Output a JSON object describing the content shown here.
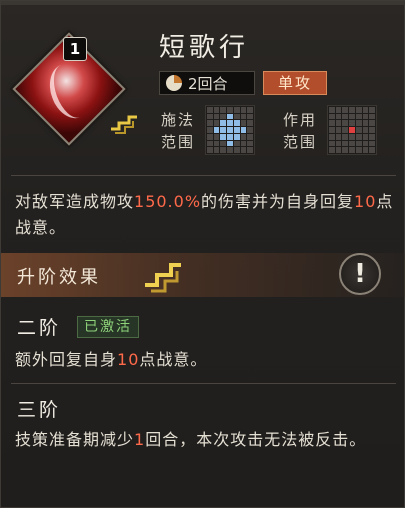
{
  "skill": {
    "level": "1",
    "name": "短歌行",
    "rounds_label": "2回合",
    "attack_type": "单攻",
    "cast_range_label_1": "施法",
    "cast_range_label_2": "范围",
    "effect_range_label_1": "作用",
    "effect_range_label_2": "范围",
    "description": {
      "part1": "对敌军造成物攻",
      "value1": "150.0%",
      "part2": "的伤害并为自身回复",
      "value2": "10",
      "part3": "点战意。"
    }
  },
  "upgrade": {
    "title": "升阶效果",
    "info_icon": "!",
    "tiers": [
      {
        "title": "二阶",
        "status": "已激活",
        "desc_part1": "额外回复自身",
        "desc_value": "10",
        "desc_part2": "点战意。"
      },
      {
        "title": "三阶",
        "desc_part1": "技策准备期减少",
        "desc_value": "1",
        "desc_part2": "回合，本次攻击无法被反击。"
      }
    ]
  },
  "colors": {
    "highlight": "#ff6a4a",
    "attack_badge": "#b34e2c",
    "activated": "#8fd27a",
    "cast_cell": "#8fbde8",
    "target_cell": "#e04040"
  },
  "icons": [
    "skill-portrait-icon",
    "rune-icon",
    "hourglass-pie-icon",
    "info-icon"
  ]
}
